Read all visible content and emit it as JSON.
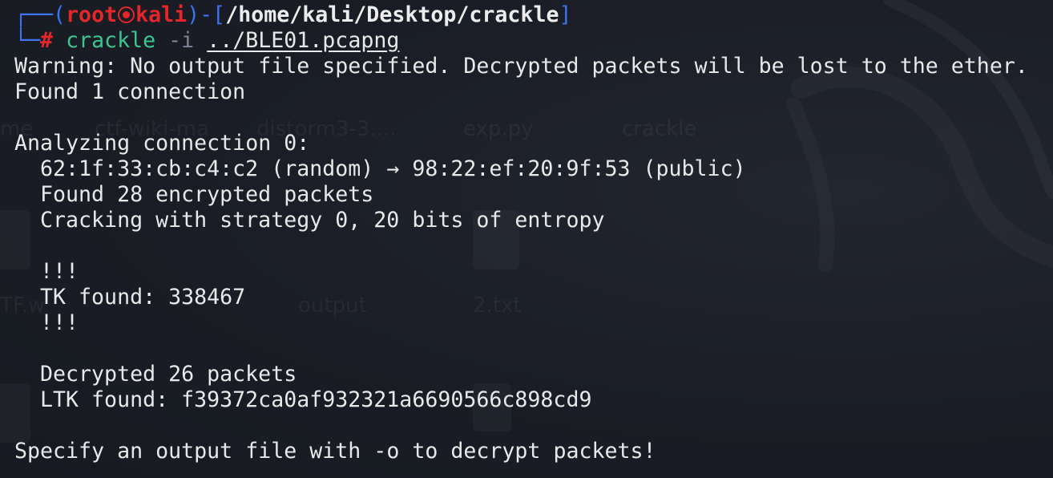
{
  "prompt": {
    "corner_top": "┌──(",
    "user": "root",
    "host": "kali",
    "mid": ")-[",
    "cwd": "/home/kali/Desktop/crackle",
    "close": "]",
    "corner_bottom": "└─",
    "hash": "#",
    "command": "crackle",
    "flag": "-i",
    "argument": "../BLE01.pcapng"
  },
  "output": {
    "warning": "Warning: No output file specified. Decrypted packets will be lost to the ether.",
    "found_connections": "Found 1 connection",
    "analyzing": "Analyzing connection 0:",
    "connection_pair": "62:1f:33:cb:c4:c2 (random) → 98:22:ef:20:9f:53 (public)",
    "encrypted_packets": "Found 28 encrypted packets",
    "strategy": "Cracking with strategy 0, 20 bits of entropy",
    "bang_open": "!!!",
    "tk_found": "TK found: 338467",
    "bang_close": "!!!",
    "decrypted": "Decrypted 26 packets",
    "ltk_found": "LTK found: f39372ca0af932321a6690566c898cd9",
    "hint": "Specify an output file with -o to decrypt packets!"
  },
  "background": {
    "labels": [
      "me",
      "ctf-wiki-ma",
      "distorm3-3....",
      "exp.py",
      "crackle",
      "TF.w",
      "output",
      "2.txt"
    ]
  },
  "colors": {
    "background": "#1b1e27",
    "prompt_frame": "#3b73f0",
    "prompt_user_host": "#e3262a",
    "command": "#3bc690",
    "flag": "#7c8494",
    "text": "#e8e8e8"
  }
}
